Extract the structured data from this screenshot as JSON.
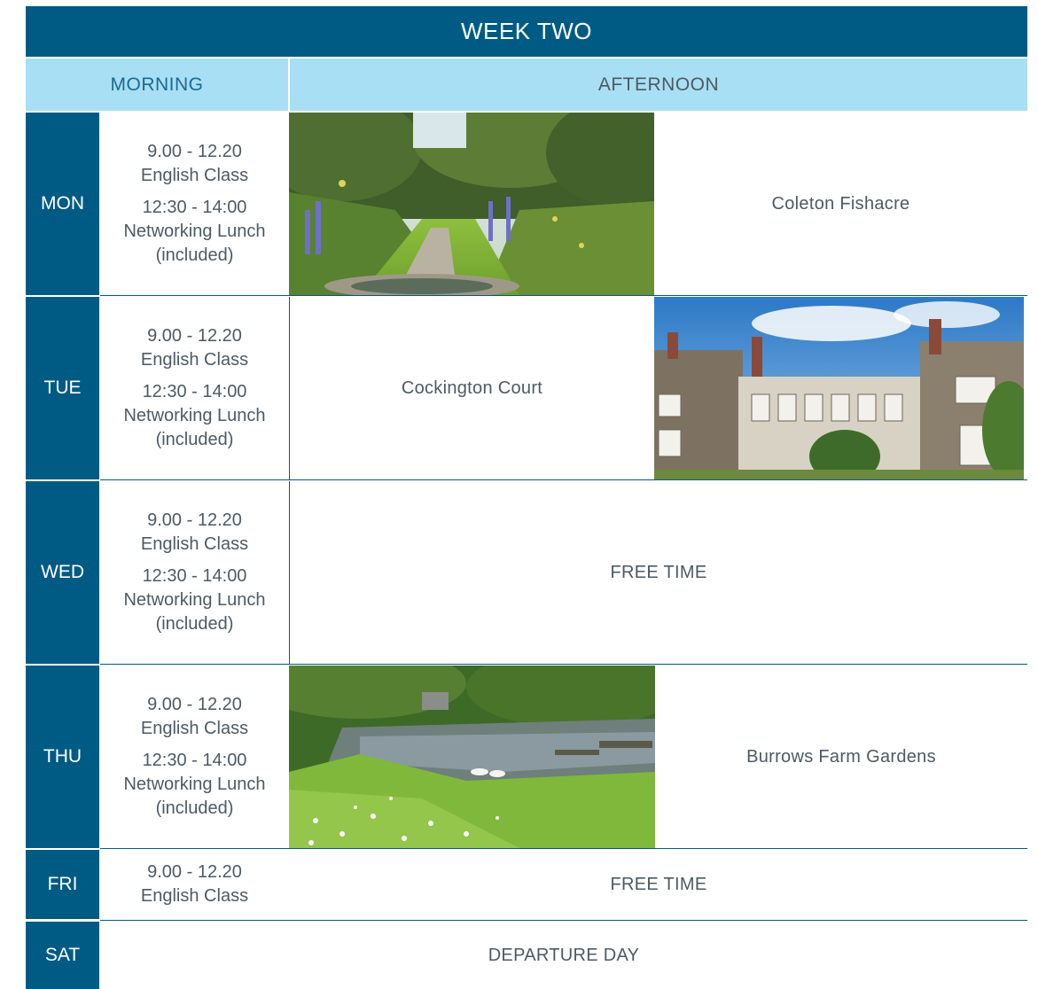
{
  "title": "WEEK TWO",
  "header": {
    "morning": "MORNING",
    "afternoon": "AFTERNOON"
  },
  "days": [
    {
      "day": "MON",
      "class_time": "9.00 - 12.20",
      "class_label": "English Class",
      "lunch_time": "12:30 - 14:00",
      "lunch_label": "Networking Lunch",
      "lunch_note": "(included)",
      "afternoon": "Coleton Fishacre"
    },
    {
      "day": "TUE",
      "class_time": "9.00 - 12.20",
      "class_label": "English Class",
      "lunch_time": "12:30 - 14:00",
      "lunch_label": "Networking Lunch",
      "lunch_note": "(included)",
      "afternoon": "Cockington Court"
    },
    {
      "day": "WED",
      "class_time": "9.00 - 12.20",
      "class_label": "English Class",
      "lunch_time": "12:30 - 14:00",
      "lunch_label": "Networking Lunch",
      "lunch_note": "(included)",
      "afternoon": "FREE TIME"
    },
    {
      "day": "THU",
      "class_time": "9.00 - 12.20",
      "class_label": "English Class",
      "lunch_time": "12:30 - 14:00",
      "lunch_label": "Networking Lunch",
      "lunch_note": "(included)",
      "afternoon": "Burrows Farm Gardens"
    },
    {
      "day": "FRI",
      "class_time": "9.00 - 12.20",
      "class_label": "English Class",
      "afternoon": "FREE TIME"
    },
    {
      "day": "SAT",
      "full_day": "DEPARTURE DAY"
    }
  ],
  "images": [
    "garden-path-photo",
    "manor-house-photo",
    "pond-garden-photo"
  ],
  "colors": {
    "dark_blue": "#005b84",
    "light_blue": "#a9dff4",
    "text_grey": "#4d5a63"
  }
}
